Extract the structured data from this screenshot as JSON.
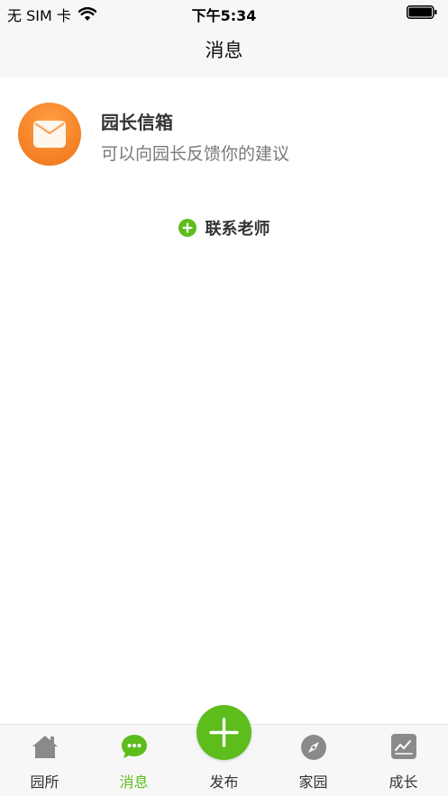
{
  "status_bar": {
    "carrier": "无 SIM 卡",
    "time": "下午5:34"
  },
  "nav": {
    "title": "消息"
  },
  "mailbox": {
    "title": "园长信箱",
    "subtitle": "可以向园长反馈你的建议",
    "icon": "envelope-icon"
  },
  "contact": {
    "label": "联系老师",
    "icon": "plus-circle-icon"
  },
  "tabs": [
    {
      "label": "园所",
      "icon": "home-icon",
      "active": false
    },
    {
      "label": "消息",
      "icon": "chat-bubble-icon",
      "active": true
    },
    {
      "label": "发布",
      "icon": "plus-icon",
      "active": false
    },
    {
      "label": "家园",
      "icon": "compass-icon",
      "active": false
    },
    {
      "label": "成长",
      "icon": "growth-chart-icon",
      "active": false
    }
  ],
  "colors": {
    "accent": "#5cbd1c",
    "mailbox": "#f7862a",
    "bar_bg": "#f7f7f7",
    "icon_grey": "#8a8a8a"
  }
}
